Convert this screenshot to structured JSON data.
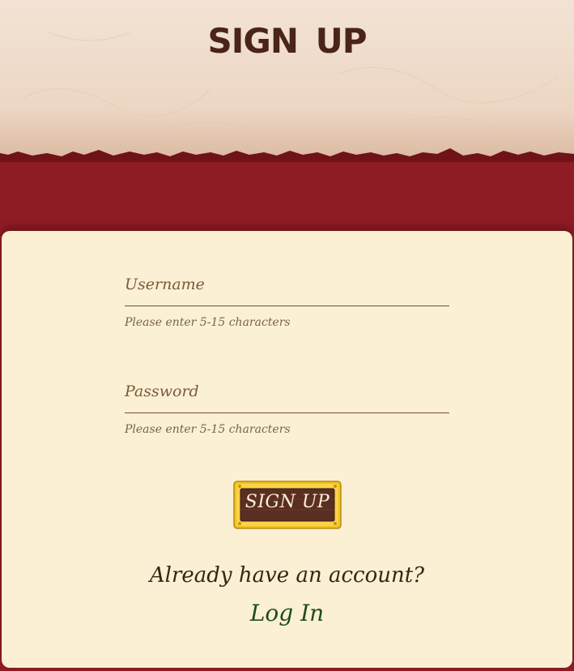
{
  "header": {
    "title": "SIGN UP"
  },
  "form": {
    "username": {
      "label": "Username",
      "hint": "Please enter 5-15 characters",
      "value": ""
    },
    "password": {
      "label": "Password",
      "hint": "Please enter 5-15 characters",
      "value": ""
    },
    "submit_label": "SIGN UP"
  },
  "footer": {
    "question": "Already have an account?",
    "login_label": "Log In"
  },
  "colors": {
    "background_red": "#8f1c25",
    "parchment": "#f4e2d2",
    "card": "#fbf0d3",
    "title_brown": "#4a2418",
    "button_gold": "#f2c31f",
    "button_wood": "#5a2e22",
    "login_green": "#1f4d1a"
  }
}
